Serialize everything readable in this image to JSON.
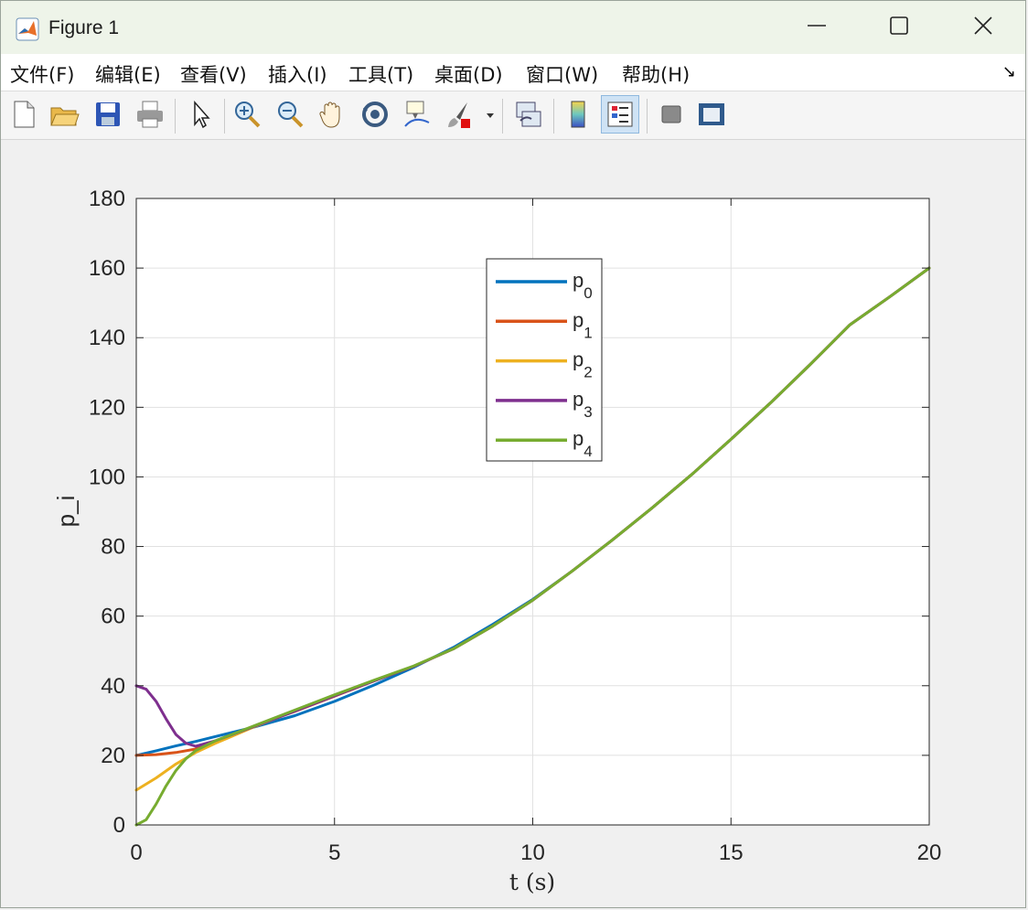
{
  "window": {
    "title": "Figure 1"
  },
  "menu": {
    "items": [
      "文件(F)",
      "编辑(E)",
      "查看(V)",
      "插入(I)",
      "工具(T)",
      "桌面(D)",
      "窗口(W)",
      "帮助(H)"
    ]
  },
  "toolbar": {
    "icons": [
      "new-figure-icon",
      "open-icon",
      "save-icon",
      "print-icon",
      "select-arrow-icon",
      "zoom-in-icon",
      "zoom-out-icon",
      "pan-hand-icon",
      "rotate-3d-icon",
      "data-cursor-icon",
      "brush-icon",
      "brush-dropdown-icon",
      "link-plot-icon",
      "colorbar-icon",
      "legend-icon",
      "hide-plot-tools-icon",
      "show-plot-tools-icon"
    ]
  },
  "chart_data": {
    "type": "line",
    "xlabel": "t (s)",
    "ylabel": "p_i",
    "xlim": [
      0,
      20
    ],
    "ylim": [
      0,
      180
    ],
    "xticks": [
      0,
      5,
      10,
      15,
      20
    ],
    "yticks": [
      0,
      20,
      40,
      60,
      80,
      100,
      120,
      140,
      160,
      180
    ],
    "grid": true,
    "legend_position": "top-center",
    "series": [
      {
        "name": "p",
        "sub": "0",
        "color": "#0072BD",
        "x": [
          0,
          0.5,
          1,
          1.5,
          2,
          3,
          4,
          5,
          6,
          7,
          8,
          9,
          10,
          11,
          12,
          13,
          14,
          15,
          16,
          17,
          18,
          19,
          20
        ],
        "y": [
          20,
          21.3,
          22.7,
          24,
          25.4,
          28.2,
          31.4,
          35.5,
          40.2,
          45.3,
          51,
          57.7,
          64.8,
          73,
          81.8,
          91,
          100.6,
          110.8,
          121.3,
          132.3,
          143.7,
          151.7,
          160
        ]
      },
      {
        "name": "p",
        "sub": "1",
        "color": "#D95319",
        "x": [
          0,
          0.5,
          1,
          1.5,
          2,
          3,
          4,
          5,
          6,
          7,
          8,
          9,
          10,
          11,
          12,
          13,
          14,
          15,
          16,
          17,
          18,
          19,
          20
        ],
        "y": [
          20,
          20.2,
          20.8,
          21.8,
          24,
          28.5,
          32.6,
          37,
          41.4,
          45.6,
          50.6,
          57.2,
          64.6,
          73,
          81.8,
          91,
          100.6,
          110.8,
          121.3,
          132.3,
          143.7,
          151.7,
          160
        ]
      },
      {
        "name": "p",
        "sub": "2",
        "color": "#EDB120",
        "x": [
          0,
          0.5,
          1,
          1.5,
          2,
          3,
          4,
          5,
          6,
          7,
          8,
          9,
          10,
          11,
          12,
          13,
          14,
          15,
          16,
          17,
          18,
          19,
          20
        ],
        "y": [
          10,
          13.5,
          17.5,
          20.8,
          23.5,
          28.3,
          32.8,
          37.2,
          41.5,
          45.6,
          50.6,
          57.2,
          64.6,
          73,
          81.8,
          91,
          100.6,
          110.8,
          121.3,
          132.3,
          143.7,
          151.7,
          160
        ]
      },
      {
        "name": "p",
        "sub": "3",
        "color": "#7E2F8E",
        "x": [
          0,
          0.25,
          0.5,
          0.75,
          1,
          1.25,
          1.5,
          2,
          3,
          4,
          5,
          6,
          7,
          8,
          9,
          10,
          11,
          12,
          13,
          14,
          15,
          16,
          17,
          18,
          19,
          20
        ],
        "y": [
          40,
          39,
          35.5,
          30.5,
          26,
          23.5,
          22.6,
          24.2,
          28.4,
          32.7,
          37.1,
          41.4,
          45.6,
          50.6,
          57.2,
          64.6,
          73,
          81.8,
          91,
          100.6,
          110.8,
          121.3,
          132.3,
          143.7,
          151.7,
          160
        ]
      },
      {
        "name": "p",
        "sub": "4",
        "color": "#77AC30",
        "x": [
          0,
          0.25,
          0.5,
          0.75,
          1,
          1.25,
          1.5,
          2,
          3,
          4,
          5,
          6,
          7,
          8,
          9,
          10,
          11,
          12,
          13,
          14,
          15,
          16,
          17,
          18,
          19,
          20
        ],
        "y": [
          0,
          1.5,
          6,
          11.2,
          15.6,
          19,
          21.4,
          24.2,
          28.6,
          33,
          37.4,
          41.6,
          45.7,
          50.6,
          57.2,
          64.6,
          73,
          81.8,
          91,
          100.6,
          110.8,
          121.3,
          132.3,
          143.7,
          151.7,
          160
        ]
      }
    ]
  }
}
